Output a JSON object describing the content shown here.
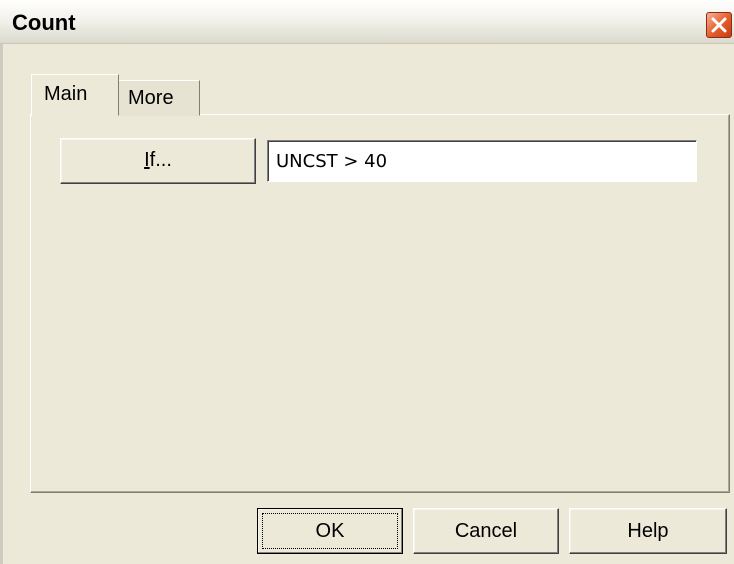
{
  "window": {
    "title": "Count",
    "close_icon": "close-x-icon"
  },
  "tabs": [
    {
      "label": "Main",
      "active": true
    },
    {
      "label": "More",
      "active": false
    }
  ],
  "main": {
    "if_button": {
      "mnemonic": "I",
      "rest": "f..."
    },
    "condition": {
      "value": "UNCST > 40"
    }
  },
  "footer": {
    "ok_label": "OK",
    "cancel_label": "Cancel",
    "help_label": "Help"
  }
}
